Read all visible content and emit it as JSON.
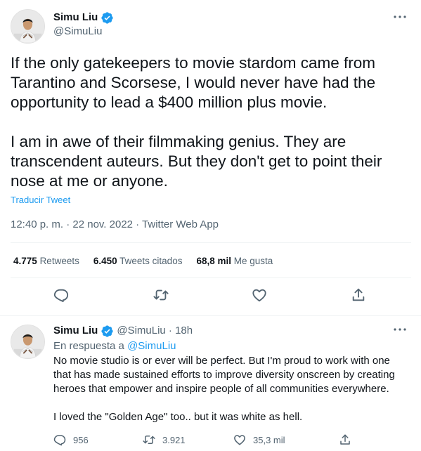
{
  "main_tweet": {
    "display_name": "Simu Liu",
    "handle": "@SimuLiu",
    "text": "If the only gatekeepers to movie stardom came from Tarantino and Scorsese, I would never have had the opportunity to lead a $400 million plus movie.\n\nI am in awe of their filmmaking genius. They are transcendent auteurs. But they don't get to point their nose at me or anyone.",
    "translate_label": "Traducir Tweet",
    "timestamp": "12:40 p. m. · 22 nov. 2022 · Twitter Web App",
    "stats": {
      "retweets_count": "4.775",
      "retweets_label": "Retweets",
      "quotes_count": "6.450",
      "quotes_label": "Tweets citados",
      "likes_count": "68,8 mil",
      "likes_label": "Me gusta"
    },
    "actions": [
      "reply-icon",
      "retweet-icon",
      "like-icon",
      "share-icon"
    ]
  },
  "reply_tweet": {
    "display_name": "Simu Liu",
    "handle": "@SimuLiu · 18h",
    "replying_prefix": "En respuesta a ",
    "replying_to": "@SimuLiu",
    "text": "No movie studio is or ever will be perfect. But I'm proud to work with one that has made sustained efforts to improve diversity onscreen by creating heroes that empower and inspire people of all communities everywhere.\n\nI loved the \"Golden Age\" too.. but it was white as hell.",
    "replies_count": "956",
    "retweets_count": "3.921",
    "likes_count": "35,3 mil"
  },
  "colors": {
    "accent": "#1d9bf0",
    "text": "#0f1419",
    "secondary_text": "#536471",
    "divider": "#eff3f4"
  }
}
